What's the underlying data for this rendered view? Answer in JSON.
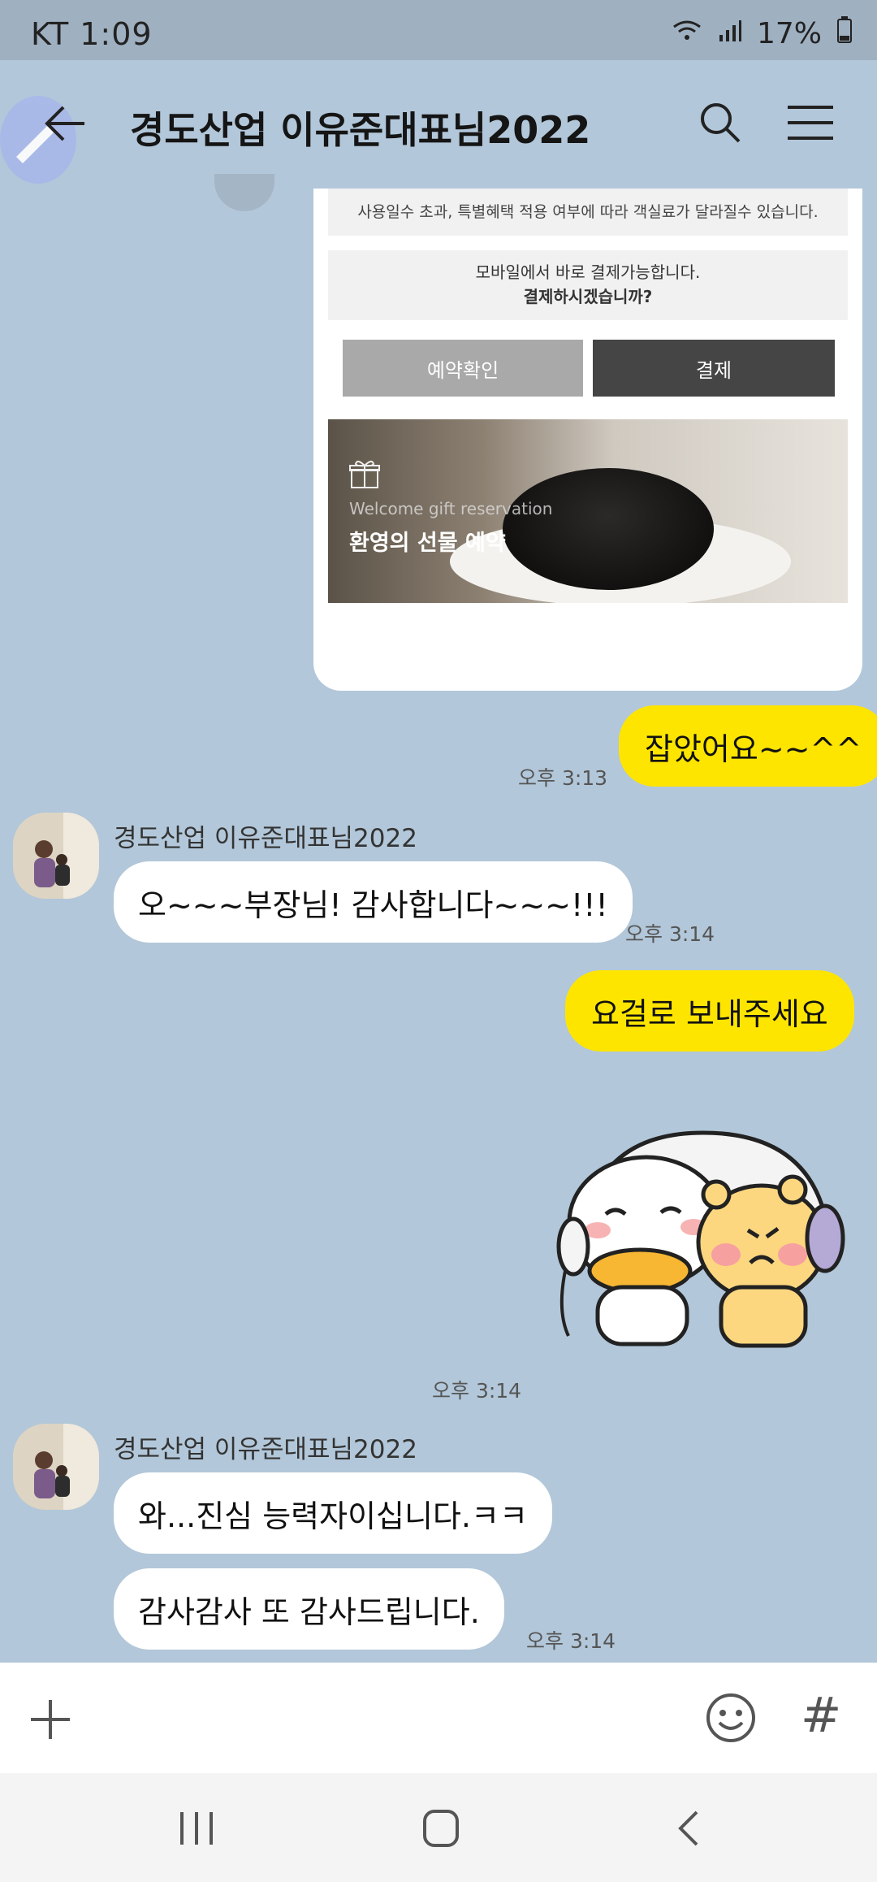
{
  "status": {
    "carrier_time": "KT 1:09",
    "battery": "17%"
  },
  "header": {
    "title": "경도산업 이유준대표님2022"
  },
  "card": {
    "notice": "사용일수 초과, 특별혜택 적용 여부에 따라 객실료가 달라질수 있습니다.",
    "pay_line1": "모바일에서 바로 결제가능합니다.",
    "pay_line2": "결제하시겠습니까?",
    "btn_confirm": "예약확인",
    "btn_pay": "결제",
    "banner_en": "Welcome gift reservation",
    "banner_ko": "환영의 선물 예약"
  },
  "messages": {
    "m1_text": "잡았어요~~^^",
    "m1_time": "오후 3:13",
    "m2_sender": "경도산업 이유준대표님2022",
    "m2_text": "오~~~부장님! 감사합니다~~~!!!",
    "m2_time": "오후 3:14",
    "m3_text": "요걸로 보내주세요",
    "m4_time": "오후 3:14",
    "m5_sender": "경도산업 이유준대표님2022",
    "m5_text1": "와...진심 능력자이십니다.ㅋㅋ",
    "m5_text2": "감사감사 또 감사드립니다.",
    "m5_time": "오후 3:14"
  },
  "input": {
    "hash": "#"
  },
  "colors": {
    "chat_bg": "#b2c7d9",
    "my_bubble": "#fee500",
    "other_bubble": "#ffffff"
  }
}
